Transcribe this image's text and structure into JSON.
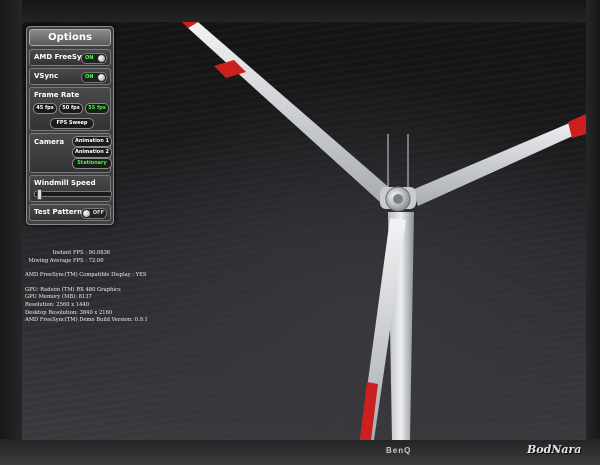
{
  "panel": {
    "title": "Options",
    "freesync": {
      "label": "AMD FreeSync™",
      "state": "ON"
    },
    "vsync": {
      "label": "VSync",
      "state": "ON"
    },
    "frame_rate": {
      "label": "Frame Rate",
      "options": [
        "45 fps",
        "50 fps",
        "55 fps"
      ],
      "selected": "55 fps"
    },
    "fps_sweep": "FPS Sweep",
    "camera": {
      "label": "Camera",
      "options": [
        "Animation 1",
        "Animation 2",
        "Stationary"
      ],
      "selected": "Stationary"
    },
    "windmill_speed": {
      "label": "Windmill Speed",
      "value_fraction": 0.03
    },
    "test_pattern": {
      "label": "Test Pattern",
      "state": "OFF"
    }
  },
  "stats": {
    "instant_fps_label": "Instant FPS :",
    "instant_fps_value": "90.0836",
    "moving_avg_label": "Moving Average FPS :",
    "moving_avg_value": "72.00",
    "compatible_display": "AMD FreeSync(TM) Compatible Display : YES",
    "gpu": "GPU: Radeon (TM) RX 480 Graphics",
    "gpu_memory": "GPU Memory (MB): 8137",
    "resolution": "Resolution: 2560 x 1440",
    "desktop_resolution": "Desktop Resolution: 3840 x 2160",
    "build_version": "AMD FreeSync(TM) Demo Build Version: 0.9.1"
  },
  "monitor": {
    "brand": "BenQ"
  },
  "watermark": "BodNara",
  "colors": {
    "on_green": "#4cff4c",
    "selected_green": "#39ff39",
    "blade_stripe": "#cc2020"
  }
}
